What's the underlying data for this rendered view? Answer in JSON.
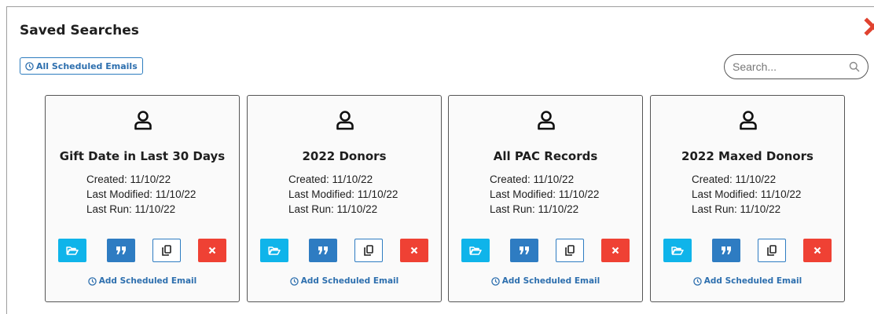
{
  "modal": {
    "title": "Saved Searches",
    "close_icon": "close-x-icon",
    "scheduled_button_label": "All Scheduled Emails",
    "search_placeholder": "Search...",
    "search_value": ""
  },
  "colors": {
    "close": "#e0422f",
    "link_blue": "#2d6fae",
    "open": "#0fb4ea",
    "quote": "#2e7cc2",
    "delete": "#ef4134"
  },
  "icons": {
    "card": "user-icon",
    "open": "folder-open-icon",
    "quote": "quote-icon",
    "copy": "copy-icon",
    "delete": "delete-x-icon",
    "clock": "clock-icon",
    "search": "search-icon"
  },
  "cards": [
    {
      "title": "Gift Date in Last 30 Days",
      "created": "Created: 11/10/22",
      "modified": "Last Modified: 11/10/22",
      "run": "Last Run: 11/10/22",
      "add_email": "Add Scheduled Email"
    },
    {
      "title": "2022 Donors",
      "created": "Created: 11/10/22",
      "modified": "Last Modified: 11/10/22",
      "run": "Last Run: 11/10/22",
      "add_email": "Add Scheduled Email"
    },
    {
      "title": "All PAC Records",
      "created": "Created: 11/10/22",
      "modified": "Last Modified: 11/10/22",
      "run": "Last Run: 11/10/22",
      "add_email": "Add Scheduled Email"
    },
    {
      "title": "2022 Maxed Donors",
      "created": "Created: 11/10/22",
      "modified": "Last Modified: 11/10/22",
      "run": "Last Run: 11/10/22",
      "add_email": "Add Scheduled Email"
    }
  ]
}
